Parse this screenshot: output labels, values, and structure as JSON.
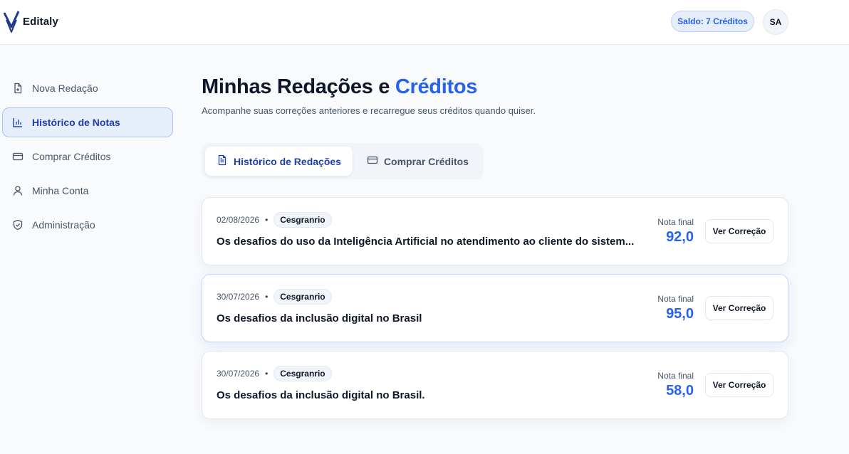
{
  "header": {
    "brand": "Editaly",
    "balance_label": "Saldo: 7 Créditos",
    "avatar_initials": "SA"
  },
  "sidebar": {
    "items": [
      {
        "label": "Nova Redação",
        "icon": "file-plus-icon",
        "active": false
      },
      {
        "label": "Histórico de Notas",
        "icon": "bar-chart-icon",
        "active": true
      },
      {
        "label": "Comprar Créditos",
        "icon": "credit-card-icon",
        "active": false
      },
      {
        "label": "Minha Conta",
        "icon": "user-icon",
        "active": false
      },
      {
        "label": "Administração",
        "icon": "shield-icon",
        "active": false
      }
    ]
  },
  "main": {
    "title_prefix": "Minhas Redações e ",
    "title_accent": "Créditos",
    "subtitle": "Acompanhe suas correções anteriores e recarregue seus créditos quando quiser.",
    "tabs": [
      {
        "label": "Histórico de Redações",
        "icon": "document-icon",
        "active": true
      },
      {
        "label": "Comprar Créditos",
        "icon": "credit-card-icon",
        "active": false
      }
    ],
    "essays": [
      {
        "date": "02/08/2026",
        "board": "Cesgranrio",
        "title": "Os desafios do uso da Inteligência Artificial no atendimento ao cliente do sistem...",
        "grade_label": "Nota final",
        "grade": "92,0",
        "button": "Ver Correção"
      },
      {
        "date": "30/07/2026",
        "board": "Cesgranrio",
        "title": "Os desafios da inclusão digital no Brasil",
        "grade_label": "Nota final",
        "grade": "95,0",
        "button": "Ver Correção"
      },
      {
        "date": "30/07/2026",
        "board": "Cesgranrio",
        "title": "Os desafios da inclusão digital no Brasil.",
        "grade_label": "Nota final",
        "grade": "58,0",
        "button": "Ver Correção"
      }
    ]
  },
  "colors": {
    "accent": "#2563eb",
    "accent_dark": "#1e40af",
    "active_bg": "#e6eefc"
  }
}
